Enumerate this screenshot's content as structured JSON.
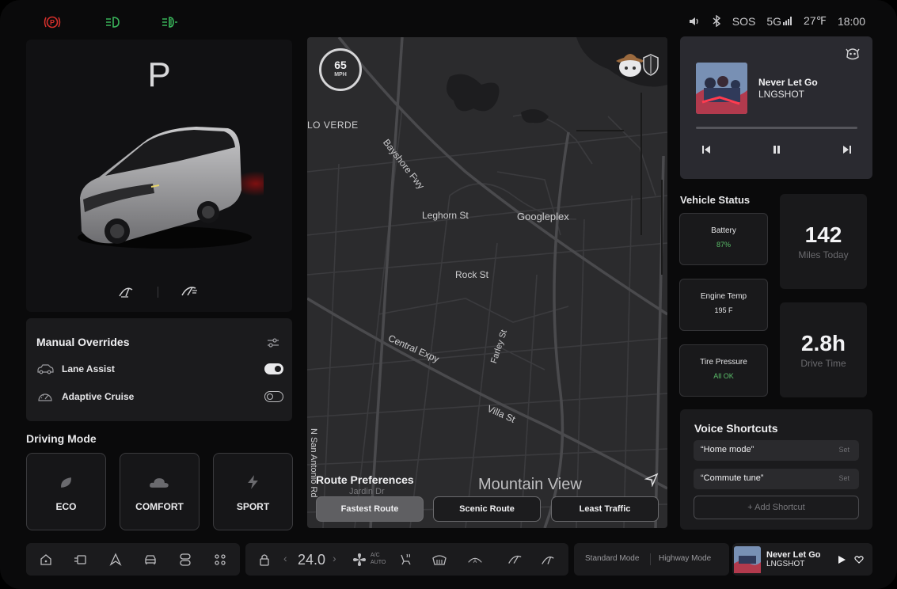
{
  "status_bar": {
    "icons_left": [
      "parking-brake-icon",
      "headlight-icon",
      "fog-light-icon"
    ],
    "sound_icon": "volume-icon",
    "bluetooth_icon": "bluetooth-icon",
    "sos": "SOS",
    "network": "5G",
    "temperature": "27℉",
    "time": "18:00"
  },
  "car": {
    "gear": "P",
    "icons": [
      "rear-wiper-icon",
      "front-wiper-icon"
    ]
  },
  "overrides": {
    "title": "Manual Overrides",
    "items": [
      {
        "label": "Lane Assist",
        "icon": "car-lane-icon",
        "on": true
      },
      {
        "label": "Adaptive Cruise",
        "icon": "speedometer-icon",
        "on": false
      }
    ]
  },
  "driving_mode": {
    "title": "Driving Mode",
    "modes": [
      {
        "label": "ECO",
        "icon": "leaf-icon"
      },
      {
        "label": "COMFORT",
        "icon": "cloud-icon"
      },
      {
        "label": "SPORT",
        "icon": "lightning-icon"
      }
    ]
  },
  "map": {
    "speed": "65",
    "speed_unit": "MPH",
    "labels": {
      "lo_verde": "LO VERDE",
      "bayshore": "Bayshore Fwy",
      "leghorn": "Leghorn St",
      "googleplex": "Googleplex",
      "rock": "Rock St",
      "farley": "Farley St",
      "central": "Central Expy",
      "villa": "Villa St",
      "san_antonio": "N San Antonio Rd",
      "jardin": "Jardin Dr",
      "mountain_view": "Mountain View"
    },
    "route_title": "Route Preferences",
    "routes": [
      {
        "label": "Fastest Route",
        "active": true
      },
      {
        "label": "Scenic Route",
        "active": false
      },
      {
        "label": "Least Traffic",
        "active": false
      }
    ]
  },
  "music": {
    "title": "Never Let Go",
    "artist": "LNGSHOT",
    "progress": 0.0
  },
  "vehicle_status": {
    "title": "Vehicle Status",
    "battery_label": "Battery",
    "battery_value": "87%",
    "engine_label": "Engine Temp",
    "engine_value": "195 F",
    "tire_label": "Tire Pressure",
    "tire_value": "All OK",
    "miles_value": "142",
    "miles_label": "Miles Today",
    "drive_value": "2.8h",
    "drive_label": "Drive Time",
    "ok_color": "#5bbf6a"
  },
  "voice": {
    "title": "Voice Shortcuts",
    "items": [
      {
        "phrase": "“Home mode”",
        "action": "Set"
      },
      {
        "phrase": "“Commute tune”",
        "action": "Set"
      }
    ],
    "add_label": "+ Add Shortcut"
  },
  "bottom_bar": {
    "nav_icons": [
      "home-icon",
      "dashboard-icon",
      "navigation-icon",
      "car-icon",
      "controls-icon",
      "apps-icon"
    ],
    "climate_temp": "24.0",
    "ac_label": "A/C",
    "auto_label": "AUTO",
    "mode_standard": "Standard Mode",
    "mode_highway": "Highway Mode",
    "mini_title": "Never Let Go",
    "mini_artist": "LNGSHOT"
  }
}
